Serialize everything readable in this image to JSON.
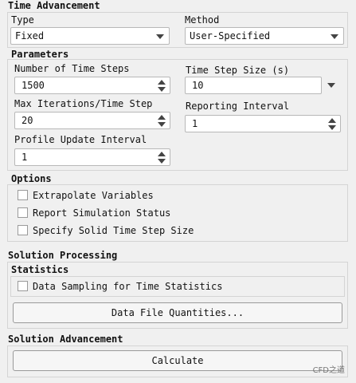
{
  "time_advancement": {
    "title": "Time Advancement",
    "type_label": "Type",
    "type_value": "Fixed",
    "method_label": "Method",
    "method_value": "User-Specified"
  },
  "parameters": {
    "title": "Parameters",
    "num_steps_label": "Number of Time Steps",
    "num_steps_value": "1500",
    "step_size_label": "Time Step Size (s)",
    "step_size_value": "10",
    "max_iter_label": "Max Iterations/Time Step",
    "max_iter_value": "20",
    "reporting_label": "Reporting Interval",
    "reporting_value": "1",
    "profile_label": "Profile Update Interval",
    "profile_value": "1"
  },
  "options": {
    "title": "Options",
    "items": [
      {
        "label": "Extrapolate Variables",
        "checked": false
      },
      {
        "label": "Report Simulation Status",
        "checked": false
      },
      {
        "label": "Specify Solid Time Step Size",
        "checked": false
      }
    ]
  },
  "solution_processing": {
    "title": "Solution Processing",
    "statistics_title": "Statistics",
    "sampling_label": "Data Sampling for Time Statistics",
    "sampling_checked": false,
    "quantities_button": "Data File Quantities..."
  },
  "solution_advancement": {
    "title": "Solution Advancement",
    "calculate_button": "Calculate"
  },
  "watermark": "CFD之道"
}
